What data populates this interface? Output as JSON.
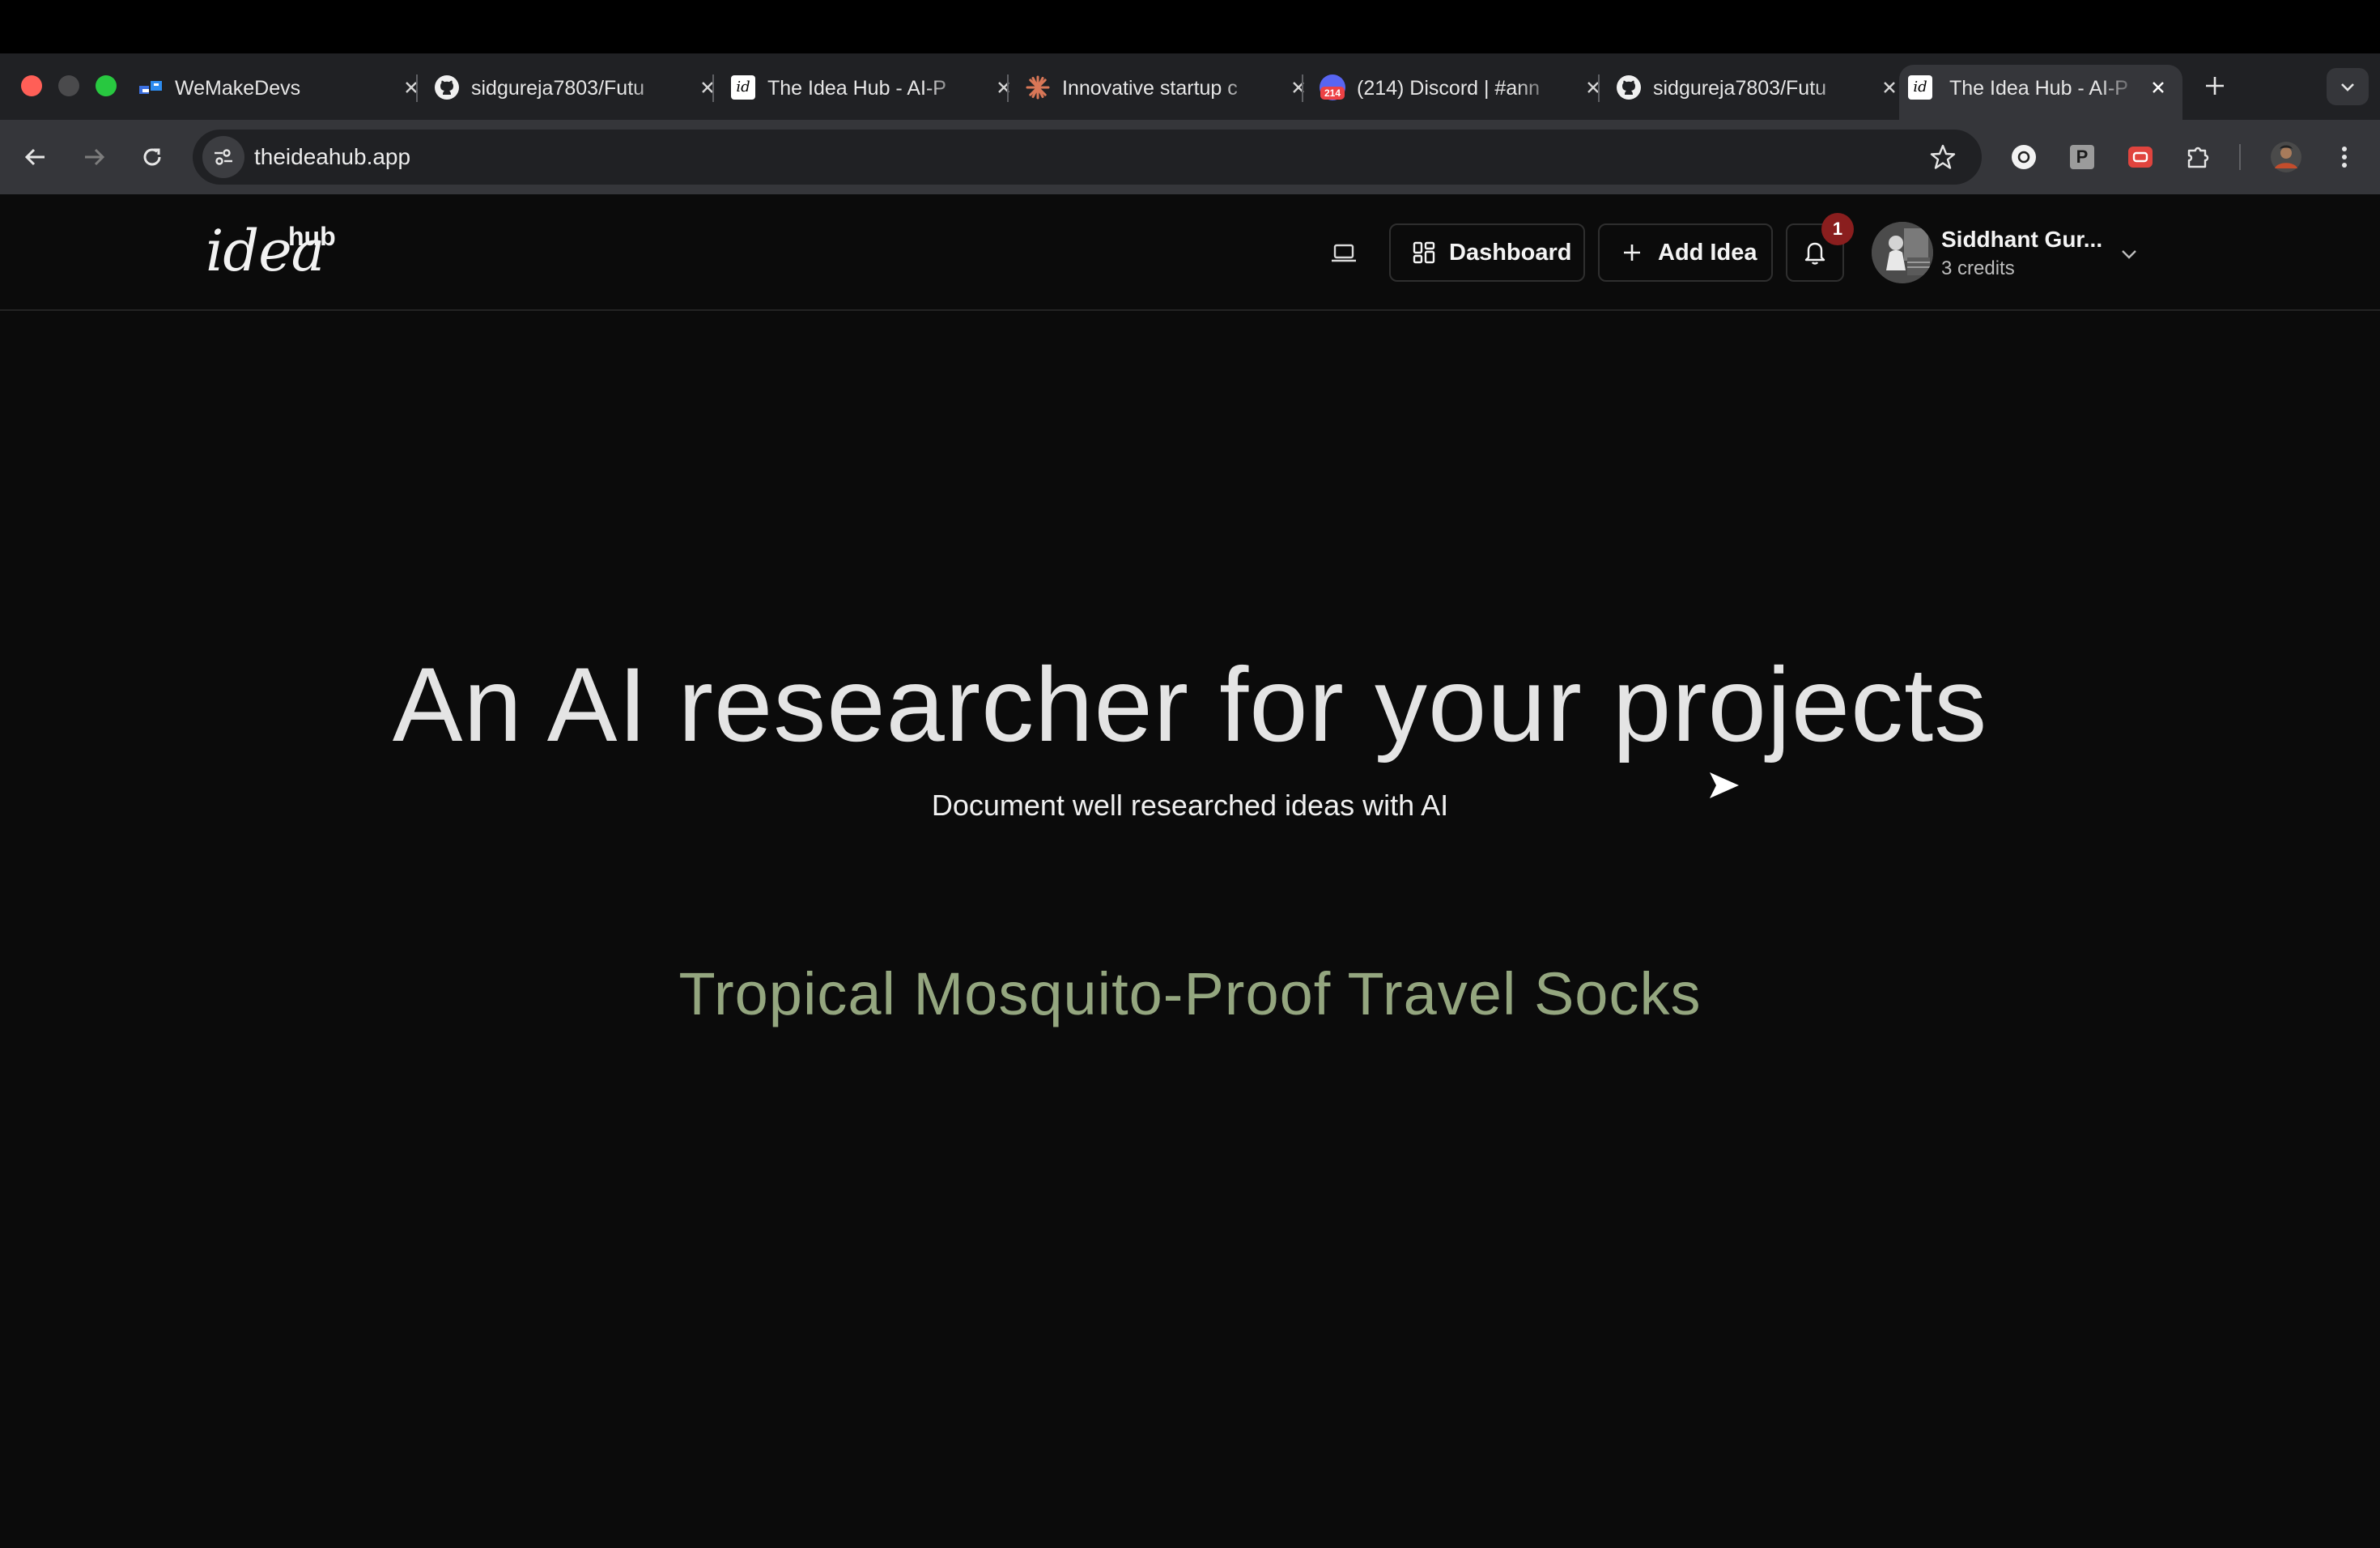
{
  "browser": {
    "tabs": [
      {
        "title": "WeMakeDevs",
        "icon": "wemakedevs-icon",
        "active": false
      },
      {
        "title": "sidgureja7803/Futu",
        "icon": "github-icon",
        "active": false
      },
      {
        "title": "The Idea Hub - AI-P",
        "icon": "idea-hub-icon",
        "active": false
      },
      {
        "title": "Innovative startup c",
        "icon": "claude-icon",
        "active": false
      },
      {
        "title": "(214) Discord | #ann",
        "icon": "discord-icon",
        "active": false
      },
      {
        "title": "sidgureja7803/Futu",
        "icon": "github-icon",
        "active": false
      },
      {
        "title": "The Idea Hub - AI-P",
        "icon": "idea-hub-icon",
        "active": true
      }
    ],
    "discord_badge": "214",
    "url": "theideahub.app",
    "ext_p_label": "P",
    "favicon_label": "id"
  },
  "site": {
    "logo": {
      "main": "idea",
      "sup": "hub"
    },
    "nav": {
      "dashboard": "Dashboard",
      "add_idea": "Add Idea",
      "notification_count": "1"
    },
    "user": {
      "name": "Siddhant Gur...",
      "credits": "3 credits"
    }
  },
  "hero": {
    "title": "An AI researcher for your projects",
    "subtitle": "Document well researched ideas with AI",
    "idea": "Tropical Mosquito-Proof Travel Socks"
  },
  "colors": {
    "background": "#0b0b0b",
    "idea_text": "#94a67f",
    "badge": "#8a1e1e"
  }
}
